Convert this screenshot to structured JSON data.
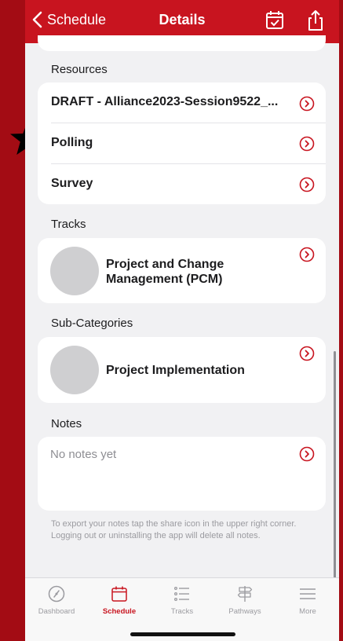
{
  "nav": {
    "back_label": "Schedule",
    "title": "Details",
    "bar_color": "#c8141f"
  },
  "resources": {
    "header": "Resources",
    "items": [
      {
        "label": "DRAFT - Alliance2023-Session9522_..."
      },
      {
        "label": "Polling"
      },
      {
        "label": "Survey"
      }
    ]
  },
  "tracks": {
    "header": "Tracks",
    "items": [
      {
        "title": "Project and Change Management (PCM)"
      }
    ]
  },
  "subcategories": {
    "header": "Sub-Categories",
    "items": [
      {
        "title": "Project Implementation"
      }
    ]
  },
  "notes": {
    "header": "Notes",
    "placeholder": "No notes yet",
    "help_text": "To export your notes tap the share icon in the upper right corner. Logging out or uninstalling the app will delete all notes."
  },
  "tabbar": {
    "tabs": [
      {
        "label": "Dashboard",
        "icon": "dashboard-icon",
        "active": false
      },
      {
        "label": "Schedule",
        "icon": "calendar-icon",
        "active": true
      },
      {
        "label": "Tracks",
        "icon": "list-icon",
        "active": false
      },
      {
        "label": "Pathways",
        "icon": "signpost-icon",
        "active": false
      },
      {
        "label": "More",
        "icon": "menu-icon",
        "active": false
      }
    ]
  },
  "colors": {
    "accent": "#c8141f",
    "frame": "#a30c14",
    "background": "#f1f1f3"
  }
}
